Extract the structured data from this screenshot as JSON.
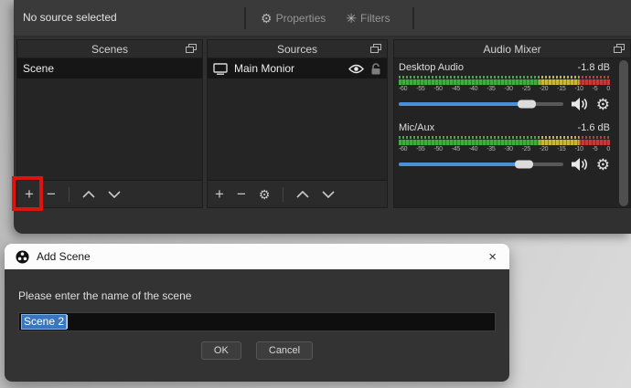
{
  "topbar": {
    "status": "No source selected",
    "properties_label": "Properties",
    "filters_label": "Filters"
  },
  "panels": {
    "scenes": {
      "title": "Scenes",
      "items": [
        {
          "name": "Scene"
        }
      ],
      "toolbar": {
        "add": "+",
        "remove": "−"
      }
    },
    "sources": {
      "title": "Sources",
      "items": [
        {
          "name": "Main Monior"
        }
      ],
      "toolbar": {
        "add": "+",
        "remove": "−",
        "gear": "⚙"
      }
    },
    "audio_mixer": {
      "title": "Audio Mixer",
      "channels": [
        {
          "name": "Desktop Audio",
          "level_db": "-1.8 dB",
          "slider_pct": 78
        },
        {
          "name": "Mic/Aux",
          "level_db": "-1.6 dB",
          "slider_pct": 76
        }
      ],
      "scale_ticks": [
        "-60",
        "-55",
        "-50",
        "-45",
        "-40",
        "-35",
        "-30",
        "-25",
        "-20",
        "-15",
        "-10",
        "-5",
        "0"
      ]
    }
  },
  "dialog": {
    "title": "Add Scene",
    "prompt": "Please enter the name of the scene",
    "input_value": "Scene 2",
    "ok_label": "OK",
    "cancel_label": "Cancel"
  },
  "icons": {
    "gear": "⚙",
    "filters": "✳",
    "plus": "+",
    "minus": "−",
    "close": "×"
  },
  "colors": {
    "highlight_red": "#dc1410",
    "selection_blue": "#3a76bd",
    "slider_blue": "#4a90d9",
    "meter_green": "#3fae3f",
    "meter_yellow": "#c9b73a",
    "meter_red": "#c23a3a",
    "window_bg": "#303030",
    "panel_bg": "#252525",
    "dialog_body_bg": "#333333",
    "dialog_titlebar_bg": "#fcfcfc"
  }
}
